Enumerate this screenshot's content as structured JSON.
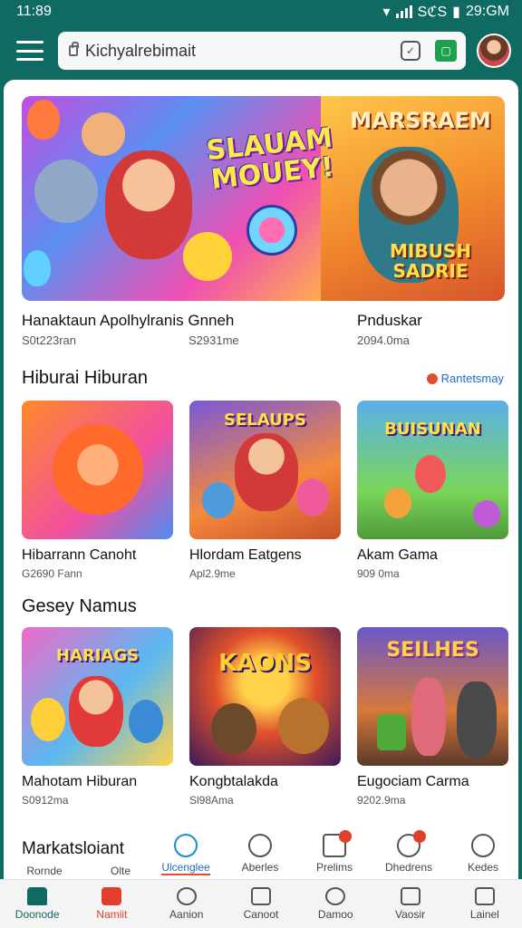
{
  "status_bar": {
    "time": "11:89",
    "right_text": "29:GM",
    "network": "SℭS"
  },
  "app_bar": {
    "search_value": "Kichyalrebimait"
  },
  "hero": {
    "banner_text_left": "SLAUAM MOUEY!",
    "banner_text_right_top": "MARSRAEM",
    "banner_text_right_bottom": "MIBUSH SADRIE",
    "caption_left": "Hanaktaun Apolhylranis Gnneh",
    "sub_left": "S0t223ran",
    "sub_mid": "S2931me",
    "caption_right": "Pnduskar",
    "sub_right": "2094.0ma"
  },
  "section1": {
    "title": "Hiburai Hiburan",
    "see_more": "Rantetsmay",
    "items": [
      {
        "name": "Hibarrann Canoht",
        "meta": "G2690 Fann",
        "art_title": ""
      },
      {
        "name": "Hlordam Eatgens",
        "meta": "Apl2.9me",
        "art_title": "SELAUPS"
      },
      {
        "name": "Akam Gama",
        "meta": "909 0ma",
        "art_title": "BUISUNAN"
      }
    ]
  },
  "section2": {
    "title": "Gesey Namus",
    "items": [
      {
        "name": "Mahotam Hiburan",
        "meta": "S0912ma",
        "art_title": "HARIAGS"
      },
      {
        "name": "Kongbtalakda",
        "meta": "Sl98Ama",
        "art_title": "KAONS"
      },
      {
        "name": "Eugociam Carma",
        "meta": "9202.9ma",
        "art_title": "SEILHES"
      }
    ]
  },
  "categories": {
    "title": "Markatsloiant",
    "items": [
      {
        "label": "Rornde"
      },
      {
        "label": "Olte"
      },
      {
        "label": "Ulcenglee"
      },
      {
        "label": "Aberles"
      },
      {
        "label": "Prelims"
      },
      {
        "label": "Dhedrens"
      },
      {
        "label": "Kedes"
      }
    ]
  },
  "bottom_nav": [
    {
      "label": "Doonode",
      "icon": "home-icon"
    },
    {
      "label": "Namiit",
      "icon": "house-icon"
    },
    {
      "label": "Aanion",
      "icon": "heart-icon"
    },
    {
      "label": "Canoot",
      "icon": "wallet-icon"
    },
    {
      "label": "Damoo",
      "icon": "search-icon"
    },
    {
      "label": "Vaosir",
      "icon": "tablet-icon"
    },
    {
      "label": "Lainel",
      "icon": "list-icon"
    }
  ],
  "colors": {
    "primary": "#0f6b61",
    "accent": "#e0402b",
    "link": "#1c6cc6"
  }
}
